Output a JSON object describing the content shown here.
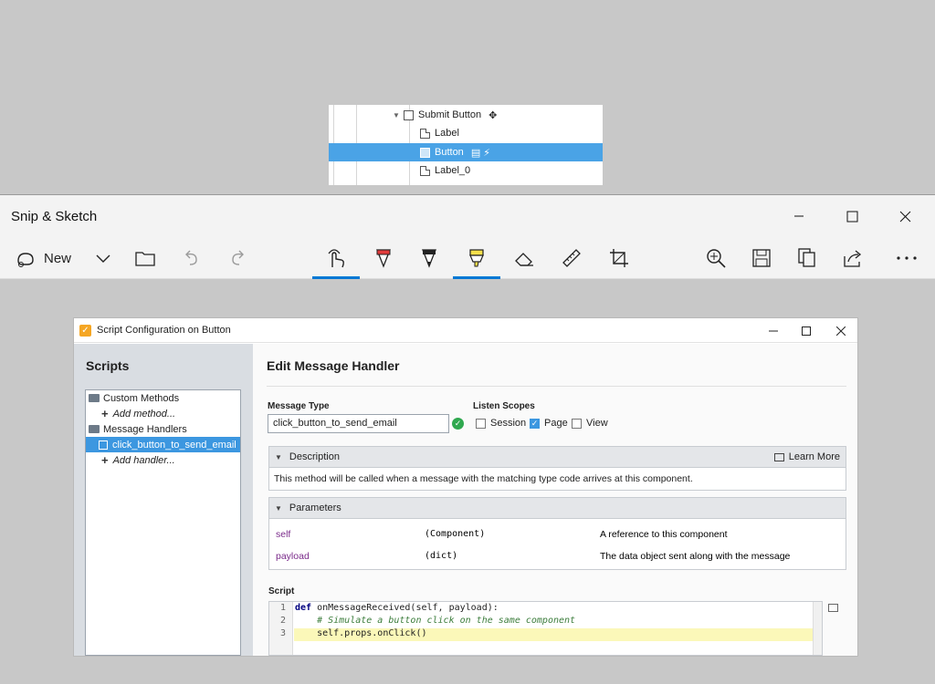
{
  "tree": {
    "items": [
      {
        "label": "Submit Button",
        "badge": "✥"
      },
      {
        "label": "Label"
      },
      {
        "label": "Button",
        "badge": "▤ ⚡"
      },
      {
        "label": "Label_0"
      }
    ]
  },
  "snip": {
    "title": "Snip & Sketch",
    "new_label": "New",
    "accent": "#0078d4"
  },
  "dialog": {
    "title": "Script Configuration on Button",
    "scripts_heading": "Scripts",
    "list": [
      "Custom Methods",
      "Add method...",
      "Message Handlers",
      "click_button_to_send_email",
      "Add handler..."
    ],
    "heading": "Edit Message Handler",
    "message_type_label": "Message Type",
    "message_type_value": "click_button_to_send_email",
    "listen_scopes_label": "Listen Scopes",
    "scopes": [
      {
        "label": "Session",
        "checked": false
      },
      {
        "label": "Page",
        "checked": true
      },
      {
        "label": "View",
        "checked": false
      }
    ],
    "description_title": "Description",
    "learn_more": "Learn More",
    "description_text": "This method will be called when a message with the matching type code arrives at this component.",
    "parameters_title": "Parameters",
    "parameters": [
      {
        "name": "self",
        "type": "(Component)",
        "desc": "A reference to this component"
      },
      {
        "name": "payload",
        "type": "(dict)",
        "desc": "The data object sent along with the message"
      }
    ],
    "script_label": "Script",
    "code": {
      "lines": [
        "1",
        "2",
        "3"
      ],
      "l1_kw": "def",
      "l1_rest": " onMessageReceived(self, payload):",
      "l2": "    # Simulate a button click on the same component",
      "l3": "    self.props.onClick()"
    }
  }
}
